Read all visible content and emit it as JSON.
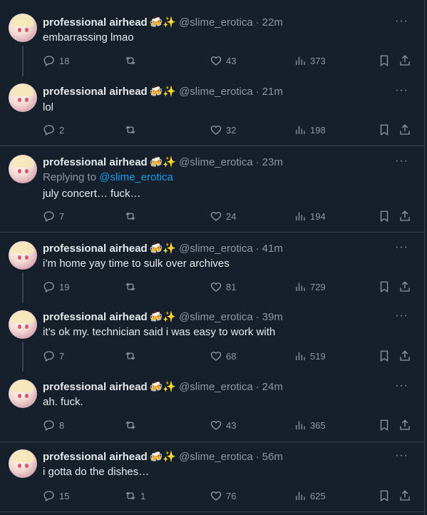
{
  "author": {
    "name": "professional airhead",
    "emoji": "🍻✨",
    "handle": "@slime_erotica"
  },
  "tweets": [
    {
      "time": "22m",
      "text": "embarrassing lmao",
      "replies": "18",
      "retweets": "",
      "likes": "43",
      "views": "373"
    },
    {
      "time": "21m",
      "text": "lol",
      "replies": "2",
      "retweets": "",
      "likes": "32",
      "views": "198"
    },
    {
      "time": "23m",
      "reply_prefix": "Replying to",
      "reply_to": "@slime_erotica",
      "text": "july concert… fuck…",
      "replies": "7",
      "retweets": "",
      "likes": "24",
      "views": "194"
    },
    {
      "time": "41m",
      "text": "i’m home yay time to sulk over archives",
      "replies": "19",
      "retweets": "",
      "likes": "81",
      "views": "729"
    },
    {
      "time": "39m",
      "text": "it’s ok my. technician said i was easy to work with",
      "replies": "7",
      "retweets": "",
      "likes": "68",
      "views": "519"
    },
    {
      "time": "24m",
      "text": "ah. fuck.",
      "replies": "8",
      "retweets": "",
      "likes": "43",
      "views": "365"
    },
    {
      "time": "56m",
      "text": "i gotta do the dishes…",
      "replies": "15",
      "retweets": "1",
      "likes": "76",
      "views": "625"
    }
  ]
}
